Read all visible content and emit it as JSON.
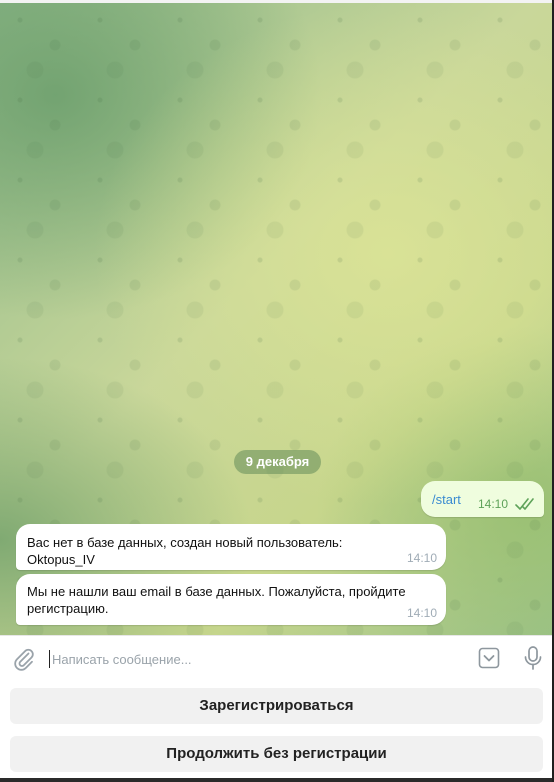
{
  "chat": {
    "date_label": "9 декабря",
    "outgoing": {
      "text": "/start",
      "time": "14:10"
    },
    "incoming": [
      {
        "text": "Вас нет в базе данных, создан новый пользователь: Oktopus_IV",
        "time": "14:10"
      },
      {
        "text": "Мы не нашли ваш email в базе данных. Пожалуйста, пройдите регистрацию.",
        "time": "14:10"
      }
    ]
  },
  "composer": {
    "placeholder": "Написать сообщение...",
    "icons": {
      "attach": "paperclip-icon",
      "keyboard": "keyboard-toggle-icon",
      "mic": "microphone-icon"
    }
  },
  "keyboard": {
    "buttons": [
      {
        "label": "Зарегистрироваться"
      },
      {
        "label": "Продолжить без регистрации"
      }
    ]
  },
  "colors": {
    "outgoing_bubble": "#effdde",
    "incoming_bubble": "#ffffff",
    "link": "#3a8bd1",
    "read_check": "#5ea259"
  }
}
